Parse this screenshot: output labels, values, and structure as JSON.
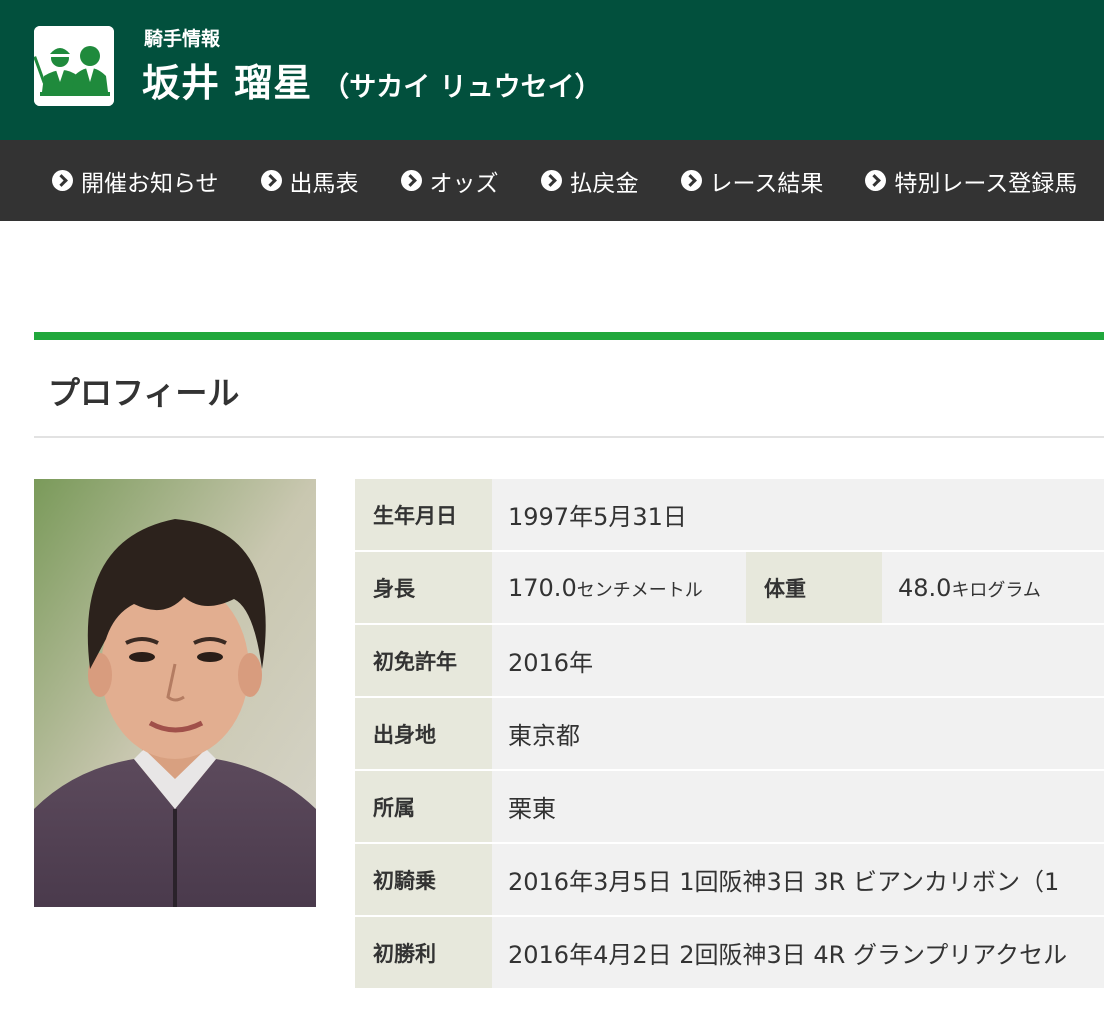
{
  "header": {
    "section_label": "騎手情報",
    "name": "坂井 瑠星",
    "kana": "（サカイ リュウセイ）",
    "logo_icon": "jockey-trainer-icon"
  },
  "nav": {
    "items": [
      {
        "label": "開催お知らせ",
        "icon": "circle-chevron-right-icon"
      },
      {
        "label": "出馬表",
        "icon": "circle-chevron-right-icon"
      },
      {
        "label": "オッズ",
        "icon": "circle-chevron-right-icon"
      },
      {
        "label": "払戻金",
        "icon": "circle-chevron-right-icon"
      },
      {
        "label": "レース結果",
        "icon": "circle-chevron-right-icon"
      },
      {
        "label": "特別レース登録馬",
        "icon": "circle-chevron-right-icon"
      }
    ]
  },
  "profile": {
    "title": "プロフィール",
    "rows": {
      "birthday": {
        "label": "生年月日",
        "value": "1997年5月31日"
      },
      "height": {
        "label": "身長",
        "value": "170.0",
        "unit": "センチメートル"
      },
      "weight": {
        "label": "体重",
        "value": "48.0",
        "unit": "キログラム"
      },
      "license_year": {
        "label": "初免許年",
        "value": "2016年"
      },
      "birthplace": {
        "label": "出身地",
        "value": "東京都"
      },
      "affiliation": {
        "label": "所属",
        "value": "栗東"
      },
      "first_ride": {
        "label": "初騎乗",
        "value": "2016年3月5日 1回阪神3日 3R ビアンカリボン（1"
      },
      "first_win": {
        "label": "初勝利",
        "value": "2016年4月2日 2回阪神3日 4R グランプリアクセル"
      }
    }
  },
  "colors": {
    "header_bg": "#02503d",
    "nav_bg": "#333333",
    "accent_green": "#21a73c",
    "th_bg": "#e7e8dc",
    "td_bg": "#f1f1f1"
  }
}
